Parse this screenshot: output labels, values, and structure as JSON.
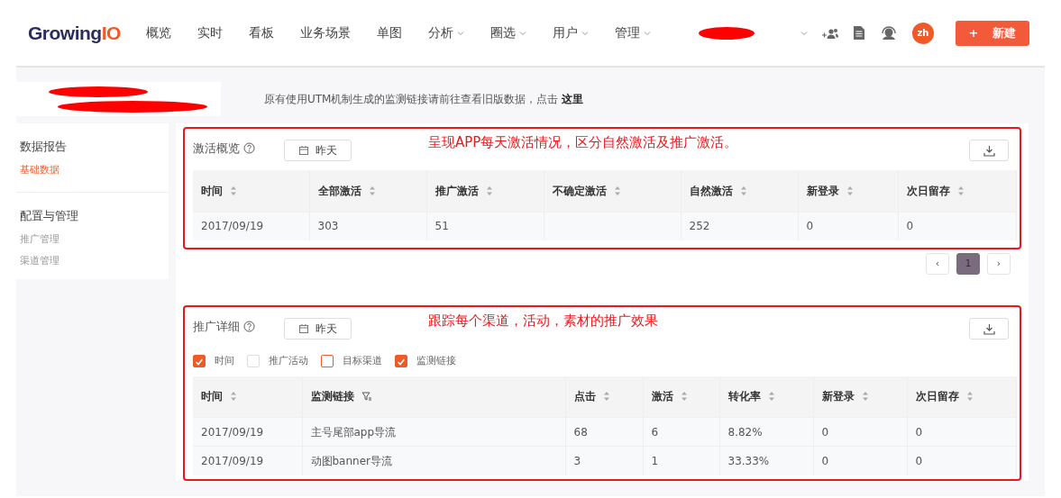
{
  "header": {
    "logo": "GrowingIO",
    "nav": [
      {
        "label": "概览",
        "dropdown": false
      },
      {
        "label": "实时",
        "dropdown": false
      },
      {
        "label": "看板",
        "dropdown": false
      },
      {
        "label": "业务场景",
        "dropdown": false
      },
      {
        "label": "单图",
        "dropdown": false
      },
      {
        "label": "分析",
        "dropdown": true
      },
      {
        "label": "圈选",
        "dropdown": true
      },
      {
        "label": "用户",
        "dropdown": true
      },
      {
        "label": "管理",
        "dropdown": true
      }
    ],
    "avatar": "zh",
    "new_icon": "+",
    "new_button": "新建"
  },
  "notice": "原有使用UTM机制生成的监测链接请前往查看旧版数据，点击 **这里**",
  "sidebar": {
    "sections": [
      {
        "title": "数据报告",
        "items": [
          {
            "label": "基础数据",
            "selected": true
          }
        ]
      },
      {
        "title": "配置与管理",
        "items": [
          {
            "label": "推广管理",
            "selected": false
          },
          {
            "label": "渠道管理",
            "selected": false
          }
        ]
      }
    ]
  },
  "panels": [
    {
      "title": "激活概览",
      "date_button": "昨天",
      "annotation": "呈现APP每天激活情况，区分自然激活及推广激活。",
      "table": {
        "columns": [
          {
            "label": "时间",
            "kind": "sort"
          },
          {
            "label": "全部激活",
            "kind": "sort"
          },
          {
            "label": "推广激活",
            "kind": "sort"
          },
          {
            "label": "不确定激活",
            "kind": "sort"
          },
          {
            "label": "自然激活",
            "kind": "sort"
          },
          {
            "label": "新登录",
            "kind": "sort"
          },
          {
            "label": "次日留存",
            "kind": "sort"
          }
        ],
        "rows": [
          [
            "2017/09/19",
            "303",
            "51",
            "",
            "252",
            "0",
            "0"
          ]
        ]
      },
      "pagination": [
        {
          "label": "‹",
          "selected": false
        },
        {
          "label": "1",
          "selected": true
        },
        {
          "label": "›",
          "selected": false
        }
      ]
    },
    {
      "title": "推广详细",
      "date_button": "昨天",
      "annotation": "跟踪每个渠道，活动，素材的推广效果",
      "filters": [
        {
          "label": "时间",
          "checked": true,
          "color": "#f05a28"
        },
        {
          "label": "推广活动",
          "checked": false,
          "color": "#dddddd"
        },
        {
          "label": "目标渠道",
          "checked": false,
          "color": "#f05a28"
        },
        {
          "label": "监测链接",
          "checked": true,
          "color": "#f05a28"
        }
      ],
      "table": {
        "columns": [
          {
            "label": "时间",
            "kind": "sort"
          },
          {
            "label": "监测链接",
            "kind": "filter"
          },
          {
            "label": "点击",
            "kind": "sort"
          },
          {
            "label": "激活",
            "kind": "sort"
          },
          {
            "label": "转化率",
            "kind": "sort"
          },
          {
            "label": "新登录",
            "kind": "sort"
          },
          {
            "label": "次日留存",
            "kind": "sort"
          }
        ],
        "rows": [
          [
            "2017/09/19",
            "主号尾部app导流",
            "68",
            "6",
            "8.82%",
            "0",
            "0"
          ],
          [
            "2017/09/19",
            "动图banner导流",
            "3",
            "1",
            "33.33%",
            "0",
            "0"
          ]
        ]
      }
    }
  ]
}
